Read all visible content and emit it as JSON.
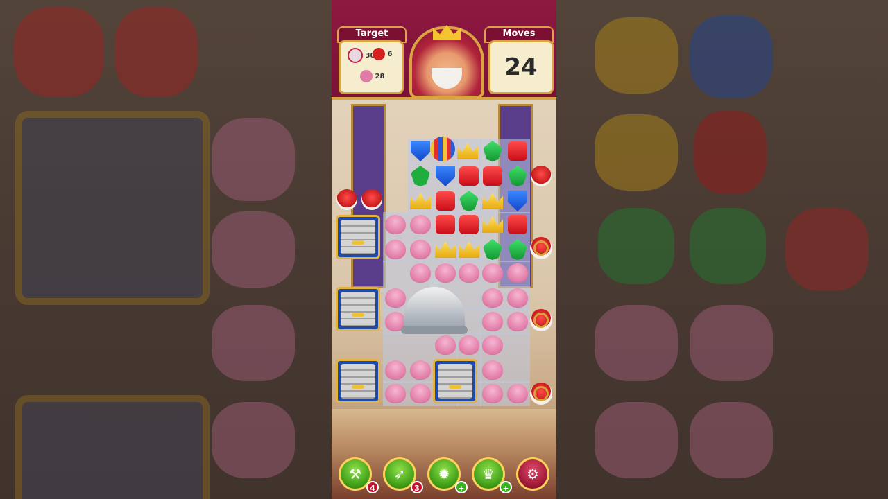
{
  "hud": {
    "target_label": "Target",
    "moves_label": "Moves",
    "moves_value": "24",
    "targets": [
      {
        "icon": "bowling-pin-icon",
        "count": "30"
      },
      {
        "icon": "red-bird-icon",
        "count": "6"
      },
      {
        "icon": "pink-shell-icon",
        "count": "28"
      }
    ]
  },
  "boosters": [
    {
      "icon": "hammer-icon",
      "badge": "4"
    },
    {
      "icon": "arrow-icon",
      "badge": "3"
    },
    {
      "icon": "cannon-icon",
      "badge": "+"
    },
    {
      "icon": "jester-hat-icon",
      "badge": "+"
    },
    {
      "icon": "gear-icon",
      "badge": ""
    }
  ],
  "colors": {
    "hud_bg": "#8e1840",
    "gold_frame": "#d9a441",
    "booster_green": "#3b9a15"
  }
}
